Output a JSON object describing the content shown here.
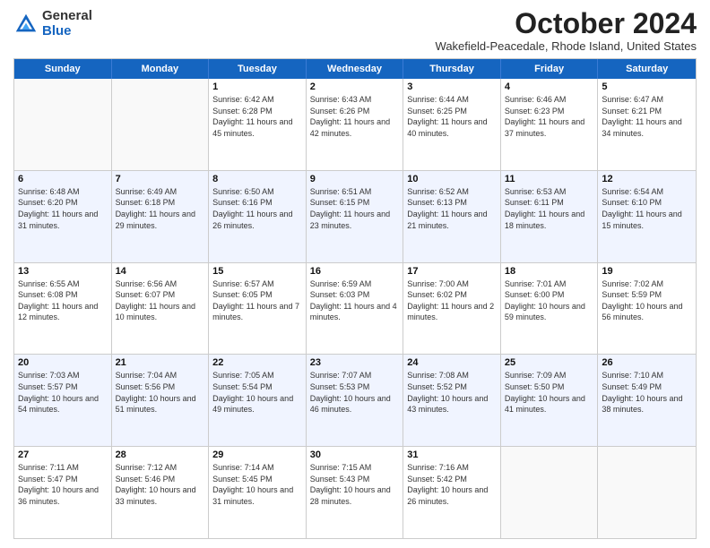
{
  "header": {
    "logo_general": "General",
    "logo_blue": "Blue",
    "month_title": "October 2024",
    "subtitle": "Wakefield-Peacedale, Rhode Island, United States"
  },
  "days_of_week": [
    "Sunday",
    "Monday",
    "Tuesday",
    "Wednesday",
    "Thursday",
    "Friday",
    "Saturday"
  ],
  "weeks": [
    [
      {
        "day": "",
        "info": ""
      },
      {
        "day": "",
        "info": ""
      },
      {
        "day": "1",
        "info": "Sunrise: 6:42 AM\nSunset: 6:28 PM\nDaylight: 11 hours and 45 minutes."
      },
      {
        "day": "2",
        "info": "Sunrise: 6:43 AM\nSunset: 6:26 PM\nDaylight: 11 hours and 42 minutes."
      },
      {
        "day": "3",
        "info": "Sunrise: 6:44 AM\nSunset: 6:25 PM\nDaylight: 11 hours and 40 minutes."
      },
      {
        "day": "4",
        "info": "Sunrise: 6:46 AM\nSunset: 6:23 PM\nDaylight: 11 hours and 37 minutes."
      },
      {
        "day": "5",
        "info": "Sunrise: 6:47 AM\nSunset: 6:21 PM\nDaylight: 11 hours and 34 minutes."
      }
    ],
    [
      {
        "day": "6",
        "info": "Sunrise: 6:48 AM\nSunset: 6:20 PM\nDaylight: 11 hours and 31 minutes."
      },
      {
        "day": "7",
        "info": "Sunrise: 6:49 AM\nSunset: 6:18 PM\nDaylight: 11 hours and 29 minutes."
      },
      {
        "day": "8",
        "info": "Sunrise: 6:50 AM\nSunset: 6:16 PM\nDaylight: 11 hours and 26 minutes."
      },
      {
        "day": "9",
        "info": "Sunrise: 6:51 AM\nSunset: 6:15 PM\nDaylight: 11 hours and 23 minutes."
      },
      {
        "day": "10",
        "info": "Sunrise: 6:52 AM\nSunset: 6:13 PM\nDaylight: 11 hours and 21 minutes."
      },
      {
        "day": "11",
        "info": "Sunrise: 6:53 AM\nSunset: 6:11 PM\nDaylight: 11 hours and 18 minutes."
      },
      {
        "day": "12",
        "info": "Sunrise: 6:54 AM\nSunset: 6:10 PM\nDaylight: 11 hours and 15 minutes."
      }
    ],
    [
      {
        "day": "13",
        "info": "Sunrise: 6:55 AM\nSunset: 6:08 PM\nDaylight: 11 hours and 12 minutes."
      },
      {
        "day": "14",
        "info": "Sunrise: 6:56 AM\nSunset: 6:07 PM\nDaylight: 11 hours and 10 minutes."
      },
      {
        "day": "15",
        "info": "Sunrise: 6:57 AM\nSunset: 6:05 PM\nDaylight: 11 hours and 7 minutes."
      },
      {
        "day": "16",
        "info": "Sunrise: 6:59 AM\nSunset: 6:03 PM\nDaylight: 11 hours and 4 minutes."
      },
      {
        "day": "17",
        "info": "Sunrise: 7:00 AM\nSunset: 6:02 PM\nDaylight: 11 hours and 2 minutes."
      },
      {
        "day": "18",
        "info": "Sunrise: 7:01 AM\nSunset: 6:00 PM\nDaylight: 10 hours and 59 minutes."
      },
      {
        "day": "19",
        "info": "Sunrise: 7:02 AM\nSunset: 5:59 PM\nDaylight: 10 hours and 56 minutes."
      }
    ],
    [
      {
        "day": "20",
        "info": "Sunrise: 7:03 AM\nSunset: 5:57 PM\nDaylight: 10 hours and 54 minutes."
      },
      {
        "day": "21",
        "info": "Sunrise: 7:04 AM\nSunset: 5:56 PM\nDaylight: 10 hours and 51 minutes."
      },
      {
        "day": "22",
        "info": "Sunrise: 7:05 AM\nSunset: 5:54 PM\nDaylight: 10 hours and 49 minutes."
      },
      {
        "day": "23",
        "info": "Sunrise: 7:07 AM\nSunset: 5:53 PM\nDaylight: 10 hours and 46 minutes."
      },
      {
        "day": "24",
        "info": "Sunrise: 7:08 AM\nSunset: 5:52 PM\nDaylight: 10 hours and 43 minutes."
      },
      {
        "day": "25",
        "info": "Sunrise: 7:09 AM\nSunset: 5:50 PM\nDaylight: 10 hours and 41 minutes."
      },
      {
        "day": "26",
        "info": "Sunrise: 7:10 AM\nSunset: 5:49 PM\nDaylight: 10 hours and 38 minutes."
      }
    ],
    [
      {
        "day": "27",
        "info": "Sunrise: 7:11 AM\nSunset: 5:47 PM\nDaylight: 10 hours and 36 minutes."
      },
      {
        "day": "28",
        "info": "Sunrise: 7:12 AM\nSunset: 5:46 PM\nDaylight: 10 hours and 33 minutes."
      },
      {
        "day": "29",
        "info": "Sunrise: 7:14 AM\nSunset: 5:45 PM\nDaylight: 10 hours and 31 minutes."
      },
      {
        "day": "30",
        "info": "Sunrise: 7:15 AM\nSunset: 5:43 PM\nDaylight: 10 hours and 28 minutes."
      },
      {
        "day": "31",
        "info": "Sunrise: 7:16 AM\nSunset: 5:42 PM\nDaylight: 10 hours and 26 minutes."
      },
      {
        "day": "",
        "info": ""
      },
      {
        "day": "",
        "info": ""
      }
    ]
  ]
}
